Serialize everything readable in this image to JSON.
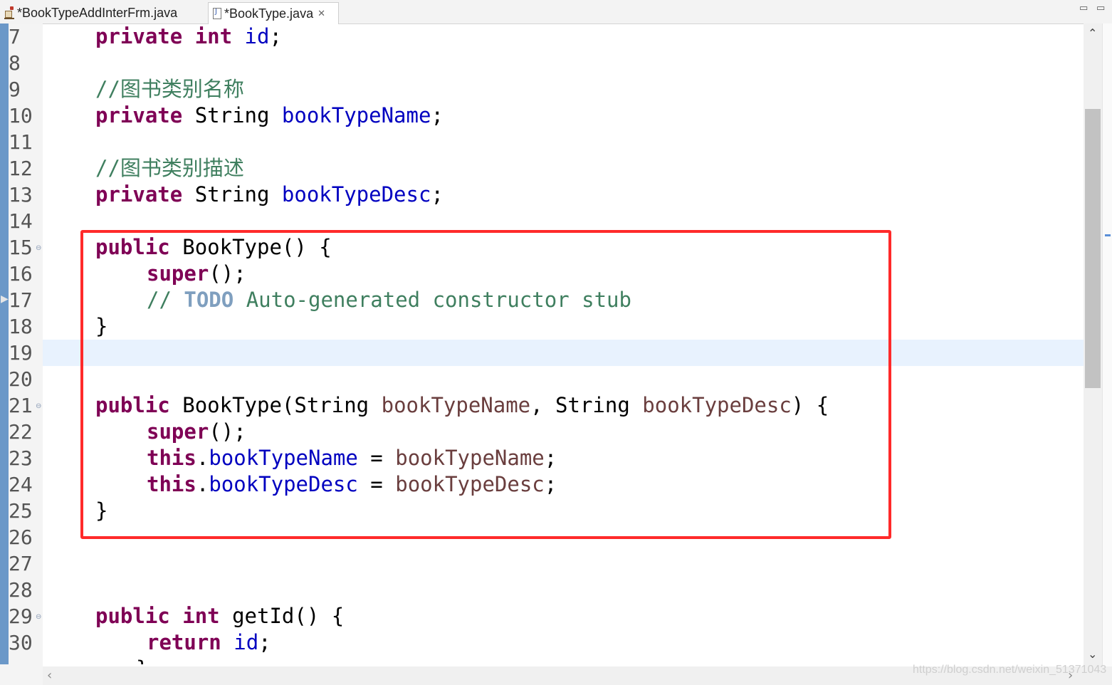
{
  "tabs": [
    {
      "label": "*BookTypeAddInterFrm.java",
      "icon": "form-class-icon",
      "active": false
    },
    {
      "label": "*BookType.java",
      "icon": "java-file-icon",
      "active": true,
      "close": "✕"
    }
  ],
  "window_controls": {
    "minimize": "▭",
    "maximize": "▭"
  },
  "line_numbers": [
    "7",
    "8",
    "9",
    "10",
    "11",
    "12",
    "13",
    "14",
    "15",
    "16",
    "17",
    "18",
    "19",
    "20",
    "21",
    "22",
    "23",
    "24",
    "25",
    "26",
    "27",
    "28",
    "29",
    "30"
  ],
  "code": {
    "l7": {
      "kw1": "private",
      "kw2": "int",
      "field": "id",
      "end": ";"
    },
    "l9": {
      "comment": "//图书类别名称"
    },
    "l10": {
      "kw1": "private",
      "type": "String",
      "field": "bookTypeName",
      "end": ";"
    },
    "l12": {
      "comment": "//图书类别描述"
    },
    "l13": {
      "kw1": "private",
      "type": "String",
      "field": "bookTypeDesc",
      "end": ";"
    },
    "l15": {
      "kw1": "public",
      "rest": "BookType() {"
    },
    "l16": {
      "kw1": "super",
      "rest": "();"
    },
    "l17": {
      "slashes": "//",
      "todo": "TODO",
      "comment": "Auto-generated constructor stub"
    },
    "l18": {
      "rest": "}"
    },
    "l21": {
      "kw1": "public",
      "sig1": "BookType(String",
      "p1": "bookTypeName",
      "sep": ", String",
      "p2": "bookTypeDesc",
      "end": ") {"
    },
    "l22": {
      "kw1": "super",
      "rest": "();"
    },
    "l23": {
      "kw1": "this",
      "dot": ".",
      "field": "bookTypeName",
      "eq": "=",
      "param": "bookTypeName",
      "end": ";"
    },
    "l24": {
      "kw1": "this",
      "dot": ".",
      "field": "bookTypeDesc",
      "eq": "=",
      "param": "bookTypeDesc",
      "end": ";"
    },
    "l25": {
      "rest": "}"
    },
    "l29": {
      "kw1": "public",
      "kw2": "int",
      "rest": "getId() {"
    },
    "l30": {
      "kw1": "return",
      "field": "id",
      "end": ";"
    },
    "l31": {
      "rest": "}"
    }
  },
  "watermark": "https://blog.csdn.net/weixin_51371043",
  "colors": {
    "keyword": "#7f0055",
    "field": "#0000c0",
    "parameter": "#6a3e3e",
    "comment": "#3f7f5f",
    "todo": "#7f9fbf",
    "highlight_box": "#ff2a2a",
    "current_line": "#e8f2fe"
  }
}
